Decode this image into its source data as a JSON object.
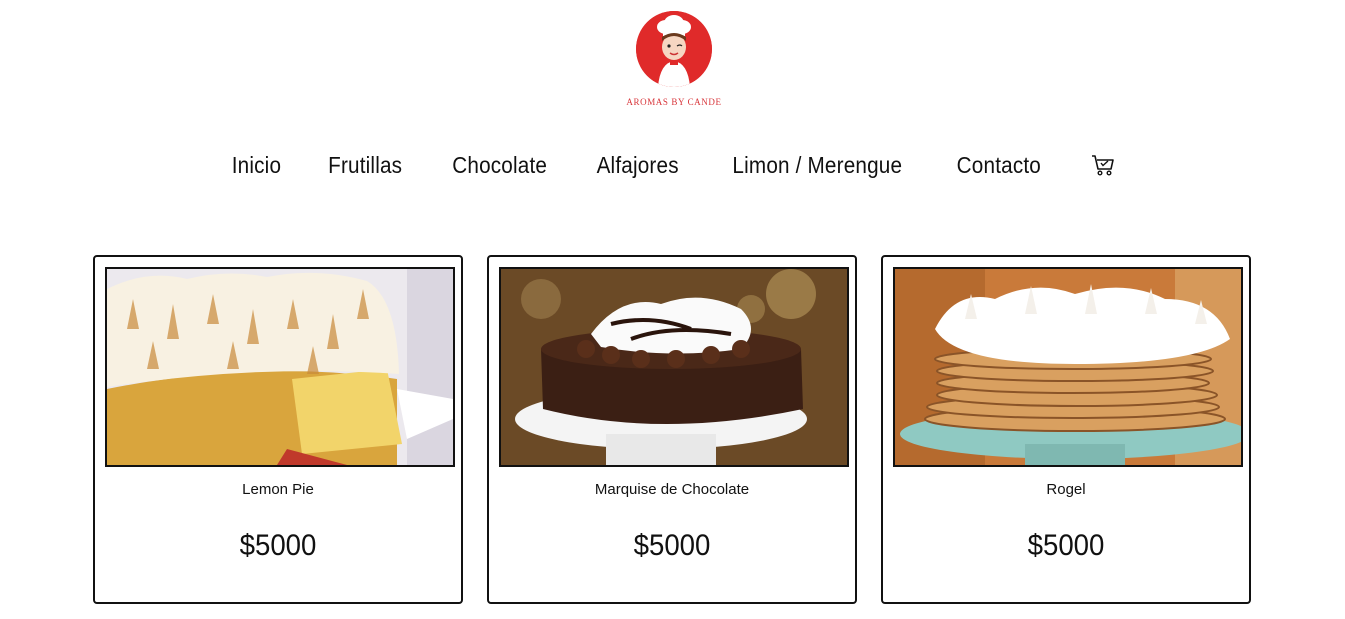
{
  "brand": {
    "name": "AROMAS BY CANDE",
    "logo_icon": "chef-logo-icon",
    "color": "#e02a2a"
  },
  "nav": {
    "items": [
      {
        "label": "Inicio"
      },
      {
        "label": "Frutillas"
      },
      {
        "label": "Chocolate"
      },
      {
        "label": "Alfajores"
      },
      {
        "label": "Limon / Merengue"
      },
      {
        "label": "Contacto"
      }
    ],
    "cart_icon": "cart-icon"
  },
  "products": [
    {
      "name": "Lemon Pie",
      "price": "$5000",
      "image_icon": "lemon-pie-image"
    },
    {
      "name": "Marquise de Chocolate",
      "price": "$5000",
      "image_icon": "chocolate-cake-image"
    },
    {
      "name": "Rogel",
      "price": "$5000",
      "image_icon": "rogel-cake-image"
    }
  ]
}
